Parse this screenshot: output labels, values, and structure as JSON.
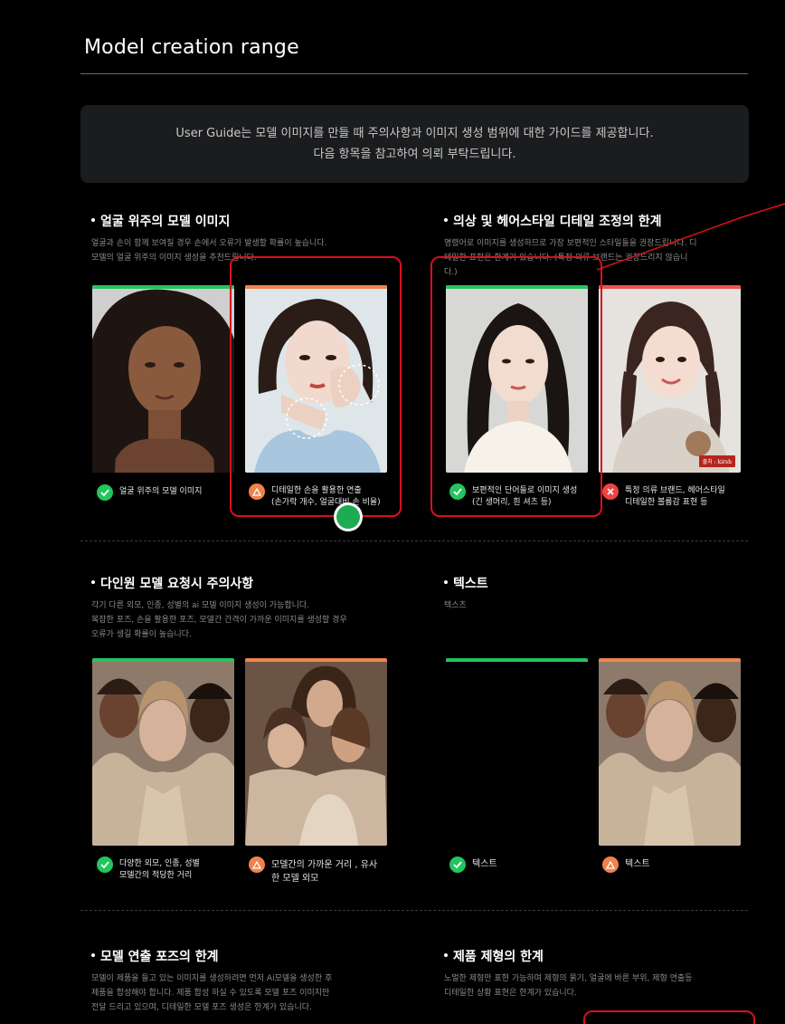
{
  "header": {
    "title": "Model creation range"
  },
  "guide": {
    "line1": "User Guide는 모델 이미지를 만들 때 주의사항과 이미지 생성 범위에 대한 가이드를 제공합니다.",
    "line2": "다음 항목을 참고하여 의뢰 부탁드립니다."
  },
  "sections": {
    "face": {
      "title": "얼굴 위주의 모델 이미지",
      "desc1": "얼굴과 손이 함께 보여질 경우 손에서 오류가 발생할 확률이 높습니다.",
      "desc2": "모델의 얼굴 위주의 이미지 생성을 추천드립니다.",
      "cap1": "얼굴 위주의 모델 이미지",
      "cap2a": "디테일한 손을 활용한 연출",
      "cap2b": "(손가락 개수, 얼굴대비 손 비율)"
    },
    "clothing": {
      "title": "의상 및 헤어스타일 디테일 조정의 한계",
      "desc1": "명령어로 이미지를 생성하므로 가장 보편적인 스타일들을 권장드립니다. 디",
      "desc2": "테일한 표현은 한계가 있습니다. (특정 의류 브랜드는 권장드리지 않습니",
      "desc3": "다.)",
      "cap1a": "보편적인 단어들로 이미지 생성",
      "cap1b": "(긴 생머리, 흰 셔츠 등)",
      "cap2a": "특정 의류 브랜드, 헤어스타일",
      "cap2b": "디테일한 볼륨감 표현 등",
      "source": "출처 : kirsh"
    },
    "multi": {
      "title": "다인원 모델 요청시 주의사항",
      "desc1": "각기 다른 외모, 인종, 성별의 ai 모델 이미지 생성이 가능합니다.",
      "desc2": "복잡한 포즈, 손을 활용한 포즈, 모델간 간격이 가까운 이미지를 생성할 경우",
      "desc3": "오류가 생길 확률이 높습니다.",
      "cap1a": "다양한 외모, 인종, 성별",
      "cap1b": "모델간의 적당한 거리",
      "cap2a": "모델간의 가까운 거리 , 유사",
      "cap2b": "한 모델 외모"
    },
    "text": {
      "title": "텍스트",
      "desc": "텍스츠",
      "cap1": "텍스트",
      "cap2": "텍스트"
    },
    "pose": {
      "title": "모델 연출 포즈의 한계",
      "desc1": "모델이 제품을 들고 있는 이미지를 생성하려면 먼저 Ai모델을 생성한 후",
      "desc2": "제품을 합성해야 합니다. 제품 합성 하실 수 있도록 모델 포즈 이미지만",
      "desc3": "전달 드리고 있으며, 디테일한 모델 포즈 생성은 한계가 있습니다."
    },
    "product": {
      "title": "제품 제형의 한계",
      "desc1": "노멀한 제형만 표현 가능하며 제형의 묽기, 얼굴에 바른 부위, 제형 연출등",
      "desc2": "디테일한 상황 표현은 한계가 있습니다."
    }
  },
  "colors": {
    "ok": "#22c55e",
    "warn": "#f0834c",
    "no": "#ef4444",
    "highlight": "#d9101b"
  }
}
